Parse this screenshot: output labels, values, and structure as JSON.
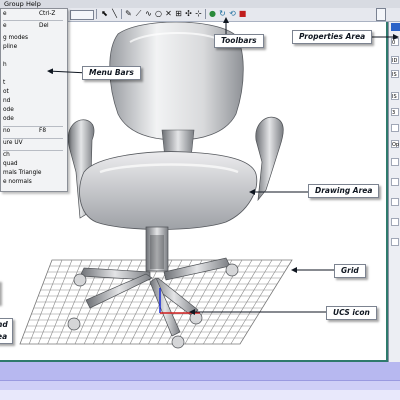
{
  "menubar": {
    "items": [
      "Group",
      "Help"
    ]
  },
  "dropdown_menu": {
    "items": [
      {
        "label": "e",
        "shortcut": "Ctrl-Z"
      },
      {
        "label": "e",
        "shortcut": "Del"
      },
      {
        "label": "g modes",
        "shortcut": ""
      },
      {
        "label": "pline",
        "shortcut": ""
      },
      {
        "label": "",
        "shortcut": ""
      },
      {
        "label": "h",
        "shortcut": ""
      },
      {
        "label": "",
        "shortcut": ""
      },
      {
        "label": "t",
        "shortcut": ""
      },
      {
        "label": "ot",
        "shortcut": ""
      },
      {
        "label": "nd",
        "shortcut": ""
      },
      {
        "label": "ode",
        "shortcut": ""
      },
      {
        "label": "ode",
        "shortcut": ""
      },
      {
        "label": "no",
        "shortcut": "F8"
      },
      {
        "label": "ure UV",
        "shortcut": ""
      },
      {
        "label": "ch",
        "shortcut": ""
      },
      {
        "label": "quad",
        "shortcut": ""
      },
      {
        "label": "mals Triangle",
        "shortcut": ""
      },
      {
        "label": "e normals",
        "shortcut": ""
      }
    ]
  },
  "callouts": {
    "toolbars": "Toolbars",
    "properties_area": "Properties Area",
    "menu_bars": "Menu Bars",
    "drawing_area": "Drawing Area",
    "grid": "Grid",
    "ucs_icon": "UCS icon",
    "partial_left_1": "nd",
    "partial_left_2": "ea"
  },
  "properties_panel": {
    "title_partial": "",
    "row_labels": [
      "0",
      "ID",
      "IS",
      "IS",
      "3",
      "",
      "Op",
      "",
      "",
      "",
      "",
      ""
    ]
  },
  "colors": {
    "frame_accent": "#2e7a6c",
    "status_bar": "#b7b8f0",
    "properties_title": "#2b63c8",
    "ucs_red": "#d22020",
    "ucs_blue": "#1a2cd8"
  }
}
